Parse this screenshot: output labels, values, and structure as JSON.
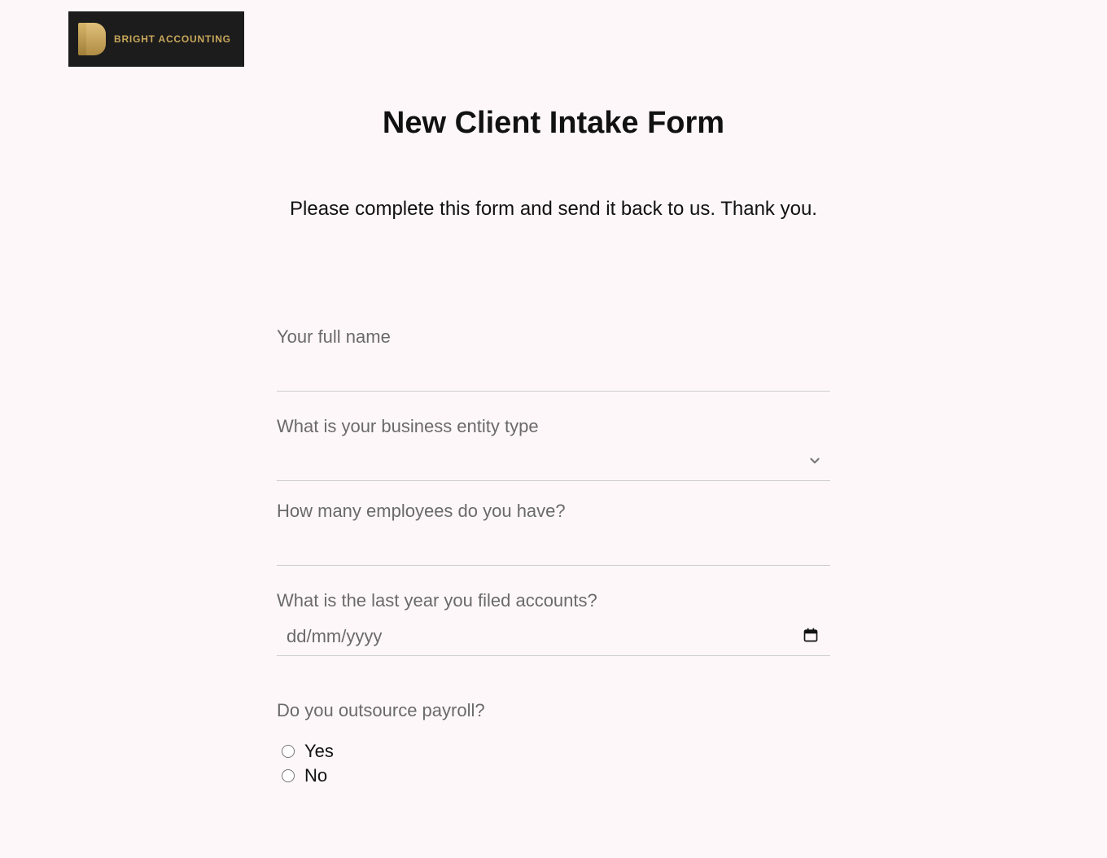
{
  "logo": {
    "text": "BRIGHT ACCOUNTING"
  },
  "title": "New Client Intake Form",
  "subtitle": "Please complete this form and send it back to us. Thank you.",
  "fields": {
    "full_name_label": "Your full name",
    "entity_type_label": "What is your business entity type",
    "employees_label": "How many employees do you have?",
    "last_filed_label": "What is the last year you filed accounts?",
    "date_placeholder": "dd/mm/yyyy",
    "outsource_label": "Do you outsource payroll?",
    "radio_yes": "Yes",
    "radio_no": "No"
  }
}
